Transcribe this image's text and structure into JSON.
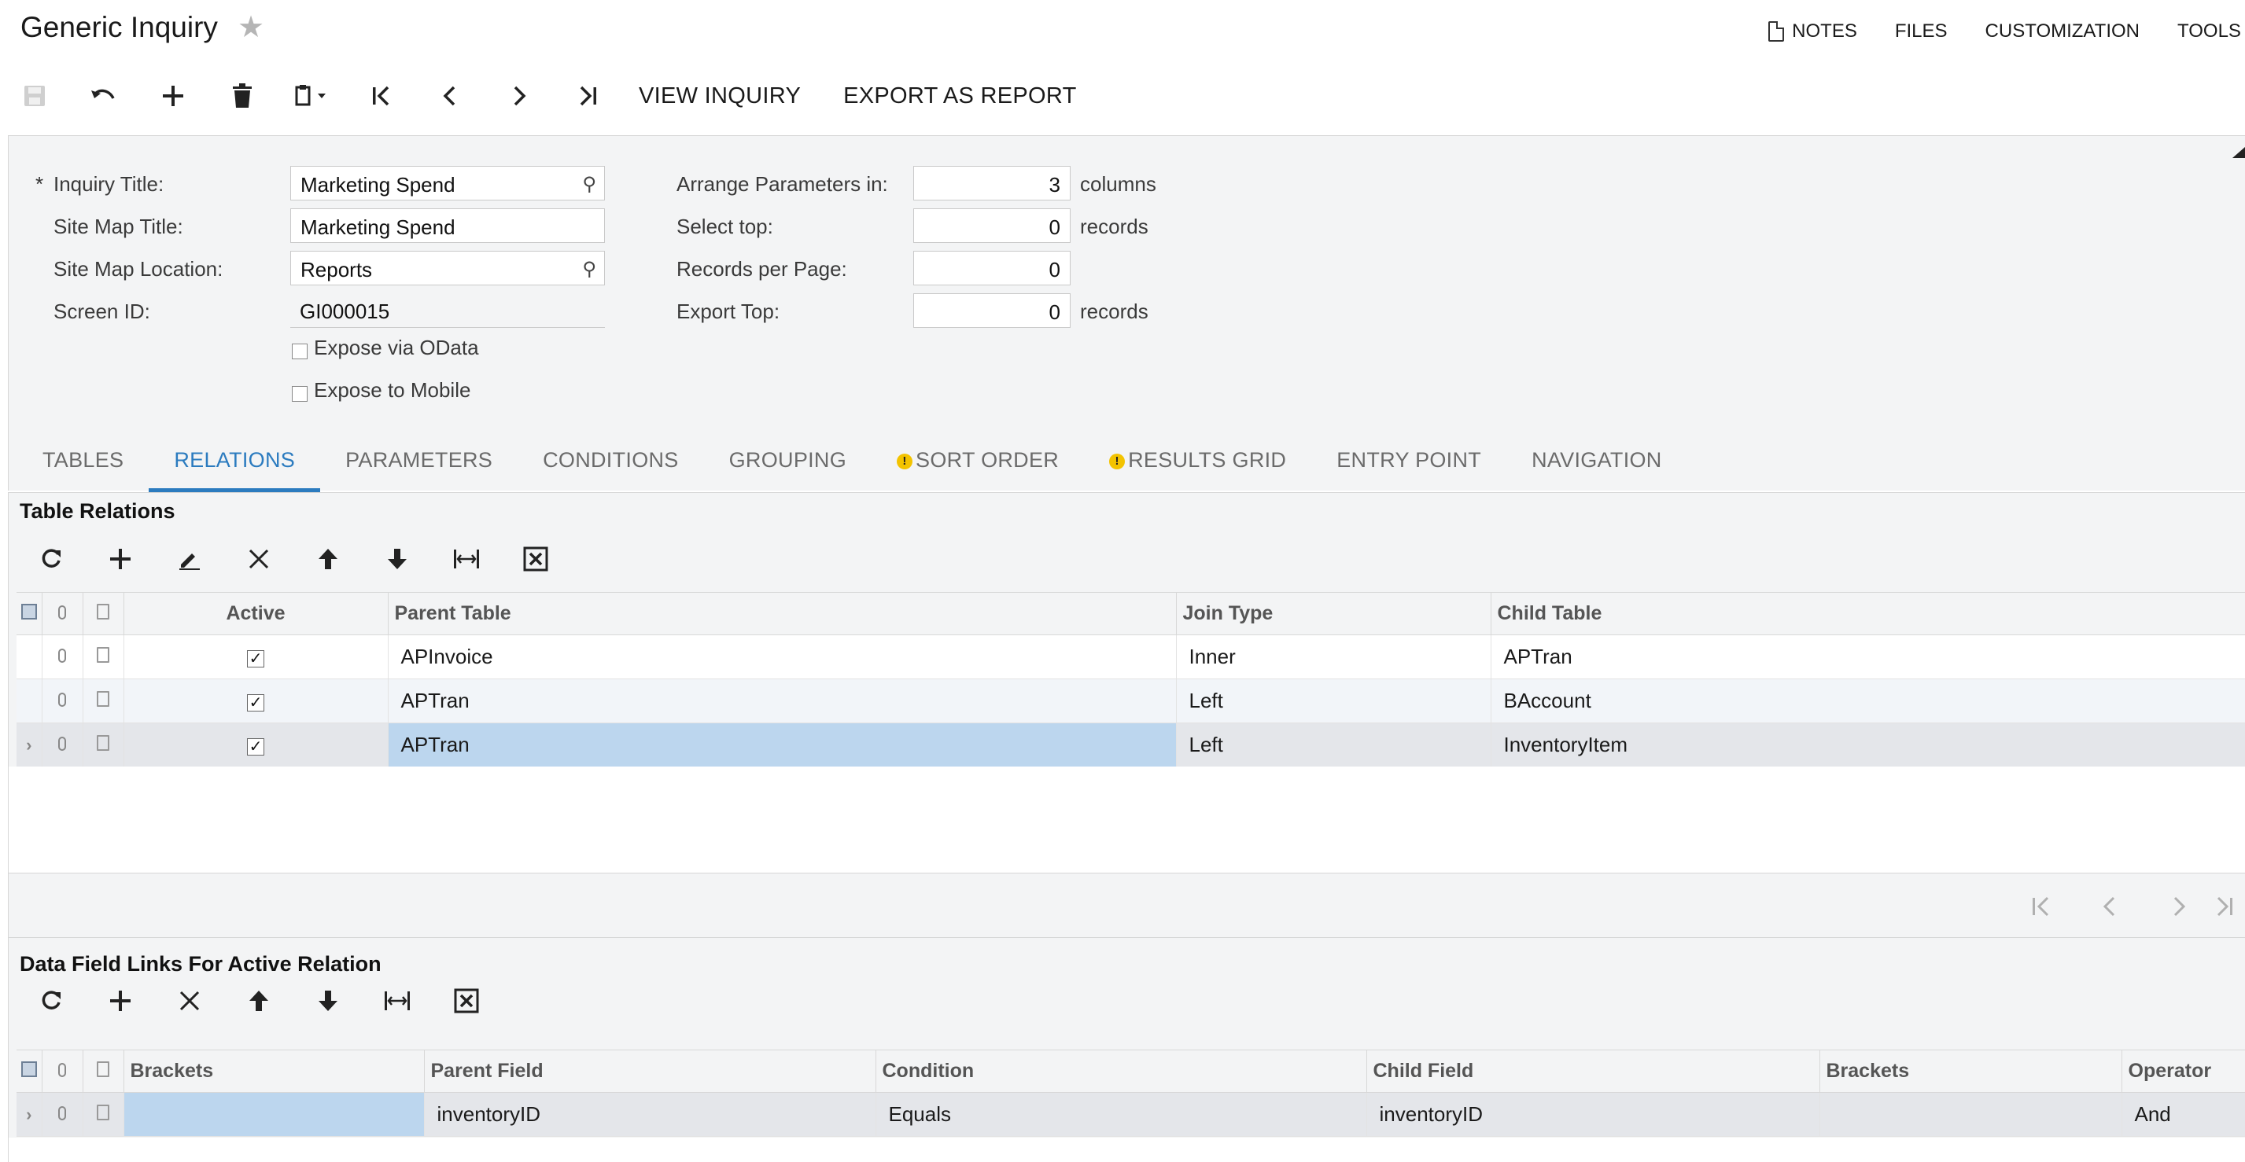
{
  "header": {
    "title": "Generic Inquiry",
    "links": [
      "NOTES",
      "FILES",
      "CUSTOMIZATION",
      "TOOLS"
    ]
  },
  "toolbar": {
    "view_inquiry": "VIEW INQUIRY",
    "export_as_report": "EXPORT AS REPORT"
  },
  "form": {
    "inquiry_title": {
      "label": "Inquiry Title:",
      "required_mark": "*",
      "value": "Marketing Spend"
    },
    "site_map_title": {
      "label": "Site Map Title:",
      "value": "Marketing Spend"
    },
    "site_map_location": {
      "label": "Site Map Location:",
      "value": "Reports"
    },
    "screen_id": {
      "label": "Screen ID:",
      "value": "GI000015"
    },
    "expose_odata": {
      "label": "Expose via OData",
      "checked": false
    },
    "expose_mobile": {
      "label": "Expose to Mobile",
      "checked": false
    },
    "arrange_params": {
      "label": "Arrange Parameters in:",
      "value": "3",
      "unit": "columns"
    },
    "select_top": {
      "label": "Select top:",
      "value": "0",
      "unit": "records"
    },
    "records_per_page": {
      "label": "Records per Page:",
      "value": "0"
    },
    "export_top": {
      "label": "Export Top:",
      "value": "0",
      "unit": "records"
    }
  },
  "tabs": [
    {
      "label": "TABLES",
      "active": false,
      "warning": false
    },
    {
      "label": "RELATIONS",
      "active": true,
      "warning": false
    },
    {
      "label": "PARAMETERS",
      "active": false,
      "warning": false
    },
    {
      "label": "CONDITIONS",
      "active": false,
      "warning": false
    },
    {
      "label": "GROUPING",
      "active": false,
      "warning": false
    },
    {
      "label": "SORT ORDER",
      "active": false,
      "warning": true
    },
    {
      "label": "RESULTS GRID",
      "active": false,
      "warning": true
    },
    {
      "label": "ENTRY POINT",
      "active": false,
      "warning": false
    },
    {
      "label": "NAVIGATION",
      "active": false,
      "warning": false
    }
  ],
  "relations": {
    "title": "Table Relations",
    "columns": [
      "Active",
      "Parent Table",
      "Join Type",
      "Child Table"
    ],
    "rows": [
      {
        "active": true,
        "parent": "APInvoice",
        "join": "Inner",
        "child": "APTran"
      },
      {
        "active": true,
        "parent": "APTran",
        "join": "Left",
        "child": "BAccount"
      },
      {
        "active": true,
        "parent": "APTran",
        "join": "Left",
        "child": "InventoryItem"
      }
    ]
  },
  "links": {
    "title": "Data Field Links For Active Relation",
    "columns": [
      "Brackets",
      "Parent Field",
      "Condition",
      "Child Field",
      "Brackets",
      "Operator"
    ],
    "rows": [
      {
        "brackets_open": "",
        "parent_field": "inventoryID",
        "condition": "Equals",
        "child_field": "inventoryID",
        "brackets_close": "",
        "operator": "And"
      }
    ]
  },
  "colors": {
    "accent": "#2b7bbf",
    "selected_cell": "#bcd6ee",
    "warning": "#f3c300"
  }
}
